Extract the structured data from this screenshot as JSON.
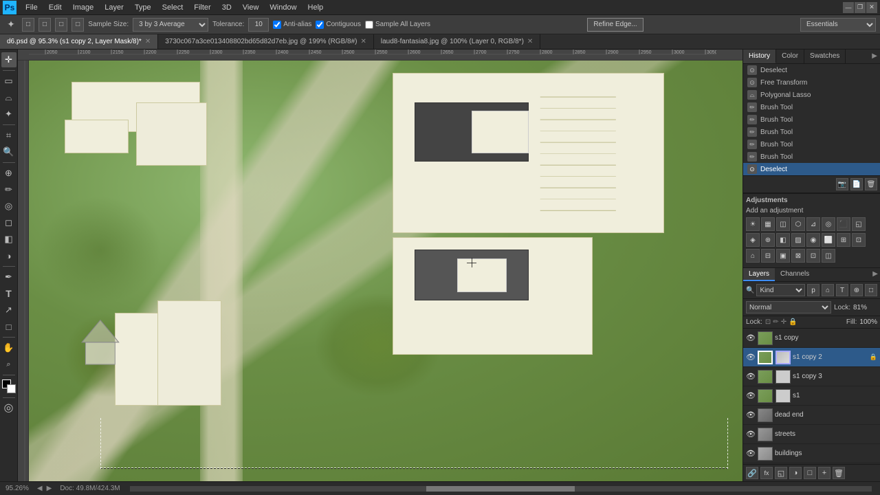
{
  "app": {
    "title": "Adobe Photoshop",
    "logo": "Ps"
  },
  "menu": {
    "items": [
      "File",
      "Edit",
      "Image",
      "Layer",
      "Type",
      "Select",
      "Filter",
      "3D",
      "View",
      "Window",
      "Help"
    ]
  },
  "window_controls": {
    "minimize": "—",
    "restore": "❐",
    "close": "✕"
  },
  "options_bar": {
    "tool_icon": "🔲",
    "icons": [
      "□",
      "□",
      "□",
      "□"
    ],
    "sample_size_label": "Sample Size:",
    "sample_size_value": "3 by 3 Average",
    "tolerance_label": "Tolerance:",
    "tolerance_value": "10",
    "anti_alias_label": "Anti-alias",
    "contiguous_label": "Contiguous",
    "sample_all_label": "Sample All Layers",
    "refine_btn": "Refine Edge..."
  },
  "doc_tabs": [
    {
      "name": "d6.psd @ 95.3% (s1 copy 2, Layer Mask/8)*",
      "active": true
    },
    {
      "name": "3730c067a3ce013408802bd65d82d7eb.jpg @ 199% (RGB/8#)",
      "active": false
    },
    {
      "name": "laud8-fantasia8.jpg @ 100% (Layer 0, RGB/8*)",
      "active": false
    }
  ],
  "canvas": {
    "ruler_labels": [
      "2050",
      "2100",
      "2150",
      "2200",
      "2250",
      "2300",
      "2350",
      "2400",
      "2450",
      "2500",
      "2550",
      "2600",
      "2650",
      "2700",
      "2750",
      "2800",
      "2850",
      "2900",
      "2950",
      "3000",
      "3050"
    ],
    "zoom": "95.26%",
    "doc_size": "Doc: 49.8M/424.3M"
  },
  "tools": [
    {
      "name": "move-tool",
      "icon": "✛",
      "label": "Move"
    },
    {
      "name": "rect-select-tool",
      "icon": "▭",
      "label": "Rectangular Marquee"
    },
    {
      "name": "lasso-tool",
      "icon": "⌓",
      "label": "Lasso"
    },
    {
      "name": "magic-wand-tool",
      "icon": "✦",
      "label": "Magic Wand",
      "active": true
    },
    {
      "name": "crop-tool",
      "icon": "⌗",
      "label": "Crop"
    },
    {
      "name": "eyedropper-tool",
      "icon": "🔍",
      "label": "Eyedropper"
    },
    {
      "name": "spot-heal-tool",
      "icon": "⊕",
      "label": "Spot Healing"
    },
    {
      "name": "brush-tool",
      "icon": "✏",
      "label": "Brush"
    },
    {
      "name": "clone-stamp-tool",
      "icon": "◎",
      "label": "Clone Stamp"
    },
    {
      "name": "eraser-tool",
      "icon": "◻",
      "label": "Eraser"
    },
    {
      "name": "gradient-tool",
      "icon": "◧",
      "label": "Gradient"
    },
    {
      "name": "dodge-tool",
      "icon": "◑",
      "label": "Dodge"
    },
    {
      "name": "pen-tool",
      "icon": "✒",
      "label": "Pen"
    },
    {
      "name": "text-tool",
      "icon": "T",
      "label": "Text"
    },
    {
      "name": "path-select-tool",
      "icon": "↗",
      "label": "Path Select"
    },
    {
      "name": "shape-tool",
      "icon": "□",
      "label": "Shape"
    },
    {
      "name": "hand-tool",
      "icon": "✋",
      "label": "Hand"
    },
    {
      "name": "zoom-tool",
      "icon": "🔍",
      "label": "Zoom"
    }
  ],
  "panels": {
    "top_tabs": [
      "History",
      "Color",
      "Swatches"
    ]
  },
  "history": {
    "items": [
      {
        "label": "Deselect",
        "icon": "⊙"
      },
      {
        "label": "Free Transform",
        "icon": "⊙"
      },
      {
        "label": "Polygonal Lasso",
        "icon": "⊙"
      },
      {
        "label": "Brush Tool",
        "icon": "✏"
      },
      {
        "label": "Brush Tool",
        "icon": "✏"
      },
      {
        "label": "Brush Tool",
        "icon": "✏"
      },
      {
        "label": "Brush Tool",
        "icon": "✏"
      },
      {
        "label": "Brush Tool",
        "icon": "✏"
      },
      {
        "label": "Deselect",
        "icon": "⊙",
        "active": true
      }
    ]
  },
  "adjustments": {
    "title": "Adjustments",
    "add_label": "Add an adjustment",
    "icons": [
      "☀",
      "▦",
      "◫",
      "⬡",
      "⊿",
      "◎",
      "⬛",
      "◱",
      "◈",
      "⊕",
      "◧",
      "▨",
      "◉",
      "⬜",
      "⊞",
      "⊡"
    ]
  },
  "layers_panel": {
    "tabs": [
      "Layers",
      "Channels"
    ],
    "filter_options": [
      "Kind"
    ],
    "blend_modes": [
      "Normal"
    ],
    "opacity": "81%",
    "fill": "100%",
    "lock_label": "Lock:",
    "layers": [
      {
        "name": "s1 copy",
        "visible": true,
        "type": "normal",
        "has_mask": false,
        "lock": false
      },
      {
        "name": "s1 copy 2",
        "visible": true,
        "type": "masked",
        "has_mask": true,
        "lock": true,
        "active": true
      },
      {
        "name": "s1 copy 3",
        "visible": true,
        "type": "masked",
        "has_mask": true,
        "lock": false
      },
      {
        "name": "s1",
        "visible": true,
        "type": "masked",
        "has_mask": true,
        "lock": false
      },
      {
        "name": "dead end",
        "visible": true,
        "type": "normal",
        "has_mask": false,
        "lock": false
      },
      {
        "name": "streets",
        "visible": true,
        "type": "normal",
        "has_mask": false,
        "lock": false
      },
      {
        "name": "buildings",
        "visible": true,
        "type": "normal",
        "has_mask": false,
        "lock": false
      }
    ],
    "bottom_icons": [
      "🔗",
      "fx",
      "◱",
      "🗑"
    ]
  },
  "status_bar": {
    "zoom": "95.26%",
    "doc_size": "Doc: 49.8M/424.3M"
  },
  "workspace": {
    "name": "Essentials"
  }
}
